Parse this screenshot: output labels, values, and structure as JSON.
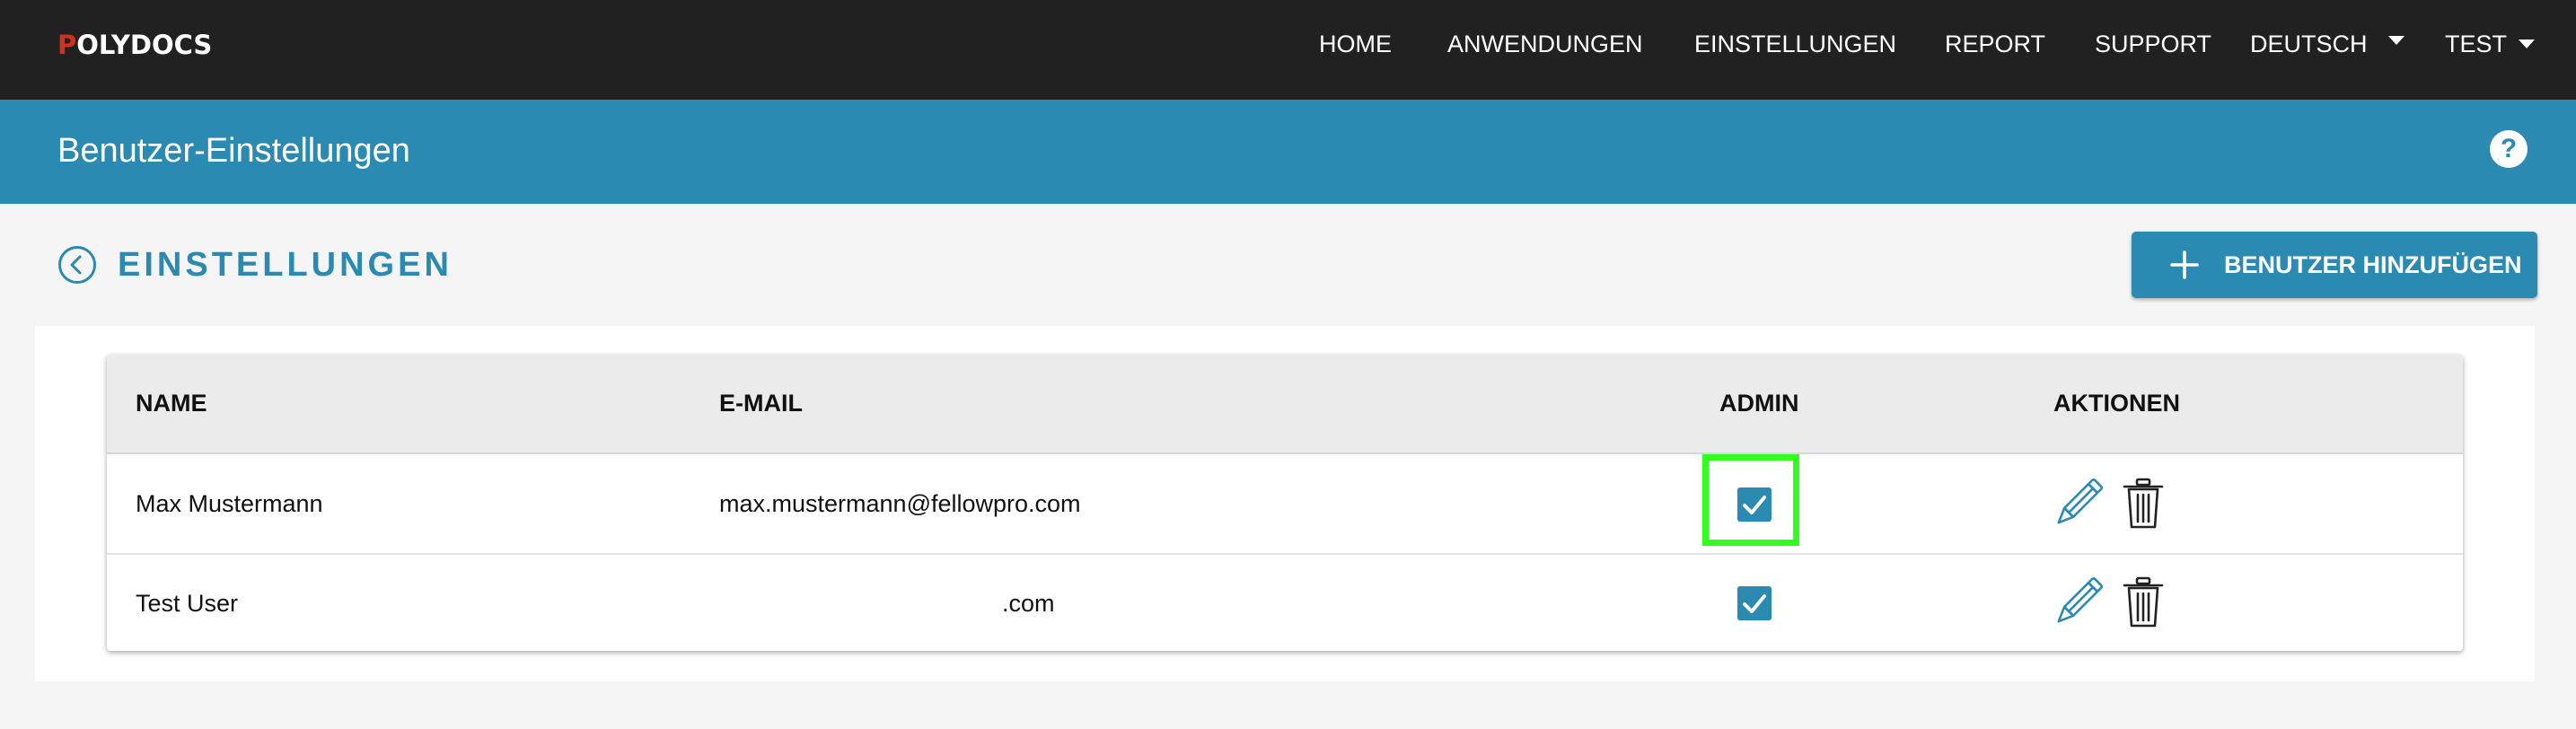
{
  "nav": {
    "logo_mark": "P",
    "logo_text": "OLYDOCS",
    "items": [
      {
        "label": "HOME"
      },
      {
        "label": "ANWENDUNGEN"
      },
      {
        "label": "EINSTELLUNGEN"
      },
      {
        "label": "REPORT"
      },
      {
        "label": "SUPPORT"
      }
    ],
    "language": "DEUTSCH",
    "user": "TEST"
  },
  "titlebar": {
    "title": "Benutzer-Einstellungen",
    "help_glyph": "?"
  },
  "section": {
    "title": "EINSTELLUNGEN",
    "add_button_label": "BENUTZER HINZUFÜGEN"
  },
  "table": {
    "columns": [
      "NAME",
      "E-MAIL",
      "ADMIN",
      "AKTIONEN"
    ],
    "rows": [
      {
        "name": "Max Mustermann",
        "email": "max.mustermann@fellowpro.com",
        "admin": true
      },
      {
        "name": "Test User",
        "email": ".com",
        "admin": true
      }
    ]
  },
  "colors": {
    "topbar": "#212121",
    "accent": "#2b8ab1",
    "logo_red": "#d0301e",
    "highlight": "#33ff1f"
  },
  "icons": {
    "back": "chevron-left-circle-icon",
    "help": "help-circle-icon",
    "add": "plus-icon",
    "edit": "pencil-icon",
    "delete": "trash-icon",
    "dropdown": "caret-down-icon",
    "checkbox": "checkbox-checked-icon"
  }
}
